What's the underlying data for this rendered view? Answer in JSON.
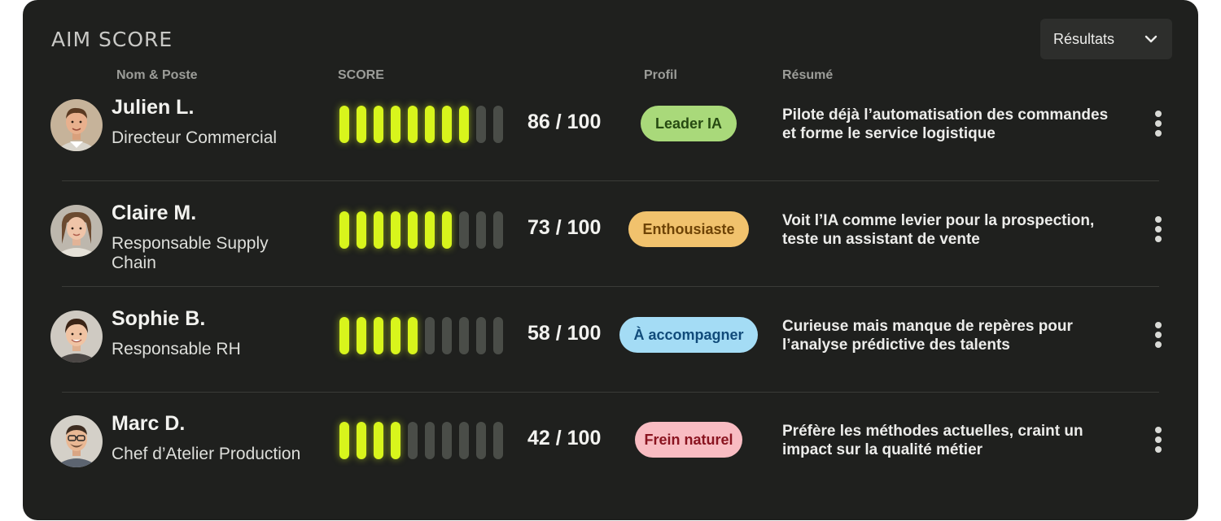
{
  "header": {
    "title": "AIM SCORE",
    "dropdown_label": "Résultats",
    "dropdown_icon": "chevron-down-icon"
  },
  "columns": {
    "name": "Nom & Poste",
    "score": "SCORE",
    "profile": "Profil",
    "summary": "Résumé"
  },
  "rows": [
    {
      "name": "Julien L.",
      "role": "Directeur Commercial",
      "score": "86 / 100",
      "bars_filled": 8,
      "bars_total": 10,
      "badge": "Leader IA",
      "badge_bg": "#a9d97a",
      "badge_fg": "#274a12",
      "summary": "Pilote déjà l’automatisation des commandes et forme le service logistique"
    },
    {
      "name": "Claire M.",
      "role": "Responsable Supply Chain",
      "score": "73 / 100",
      "bars_filled": 7,
      "bars_total": 10,
      "badge": "Enthousiaste",
      "badge_bg": "#f1c26d",
      "badge_fg": "#6e4306",
      "summary": "Voit l’IA comme levier pour la prospection, teste un assistant de vente"
    },
    {
      "name": "Sophie B.",
      "role": "Responsable RH",
      "score": "58 / 100",
      "bars_filled": 5,
      "bars_total": 10,
      "badge": "À accompagner",
      "badge_bg": "#a4dcf5",
      "badge_fg": "#114b7a",
      "summary": "Curieuse mais manque de repères pour l’analyse prédictive des talents"
    },
    {
      "name": "Marc D.",
      "role": "Chef d’Atelier Production",
      "score": "42 / 100",
      "bars_filled": 4,
      "bars_total": 10,
      "badge": "Frein naturel",
      "badge_bg": "#f8bcc2",
      "badge_fg": "#8a1420",
      "summary": "Préfère les méthodes actuelles, craint un impact sur la qualité métier"
    }
  ],
  "colors": {
    "panel_bg": "#1f201e",
    "bar_on": "#d8f51c",
    "bar_off": "#4a4d48"
  },
  "row_action_icon": "more-vertical-icon"
}
